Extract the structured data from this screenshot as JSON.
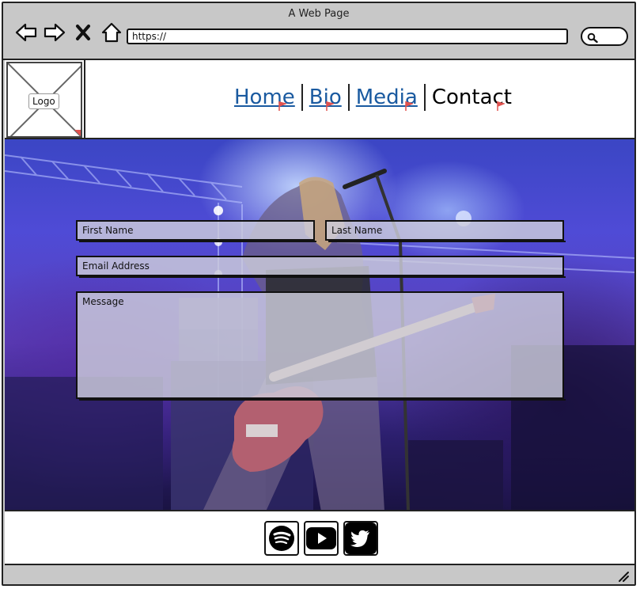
{
  "window": {
    "title": "A Web Page",
    "url": "https://"
  },
  "header": {
    "logo_label": "Logo",
    "nav": [
      {
        "label": "Home",
        "current": false
      },
      {
        "label": "Bio",
        "current": false
      },
      {
        "label": "Media",
        "current": false
      },
      {
        "label": "Contact",
        "current": true
      }
    ]
  },
  "form": {
    "first_name_placeholder": "First Name",
    "last_name_placeholder": "Last Name",
    "email_placeholder": "Email Address",
    "message_placeholder": "Message"
  },
  "footer": {
    "social": [
      {
        "name": "spotify-icon",
        "color": "#000000"
      },
      {
        "name": "youtube-icon",
        "color": "#000000"
      },
      {
        "name": "twitter-icon",
        "color": "#000000"
      }
    ]
  },
  "colors": {
    "link": "#1a5aa0",
    "chrome": "#c8c8c8",
    "flag": "#e0524f"
  }
}
